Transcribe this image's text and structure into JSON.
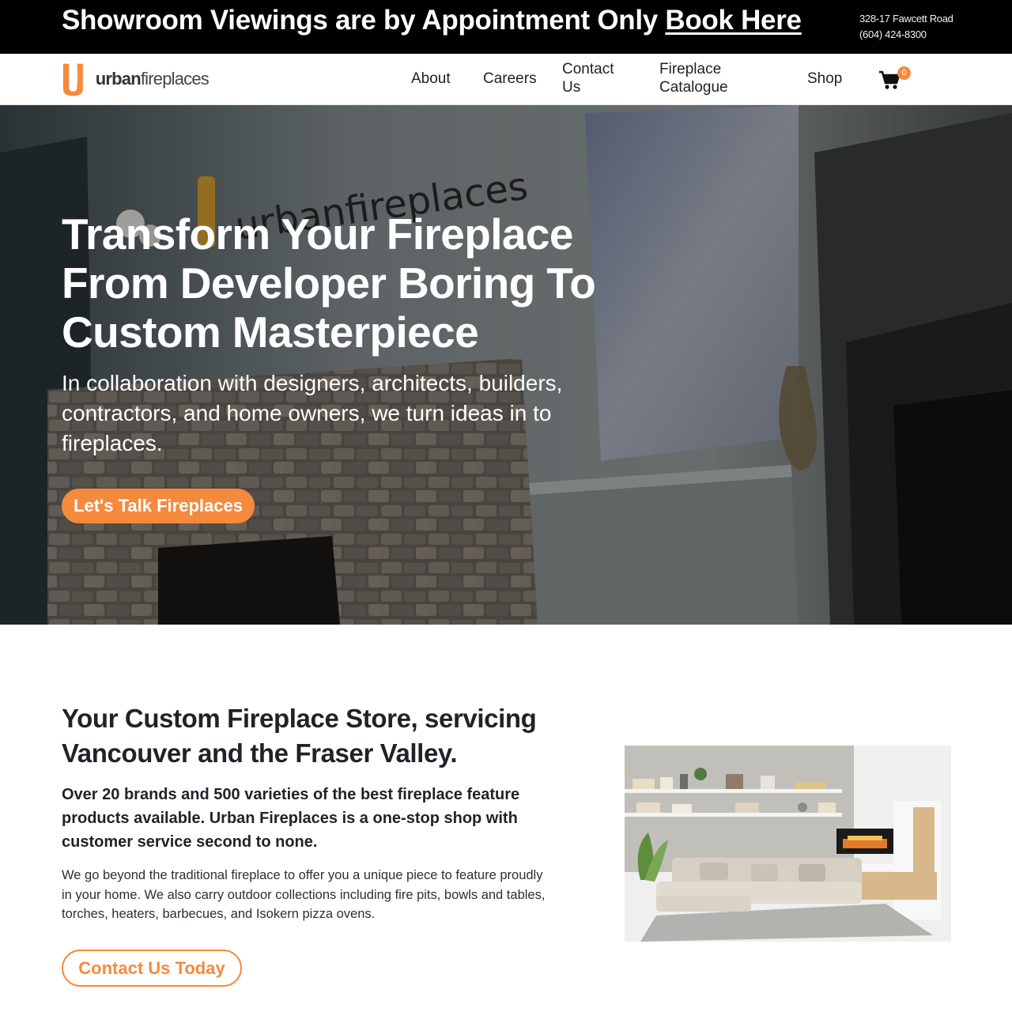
{
  "topbar": {
    "announcement": "Showroom Viewings are by Appointment Only",
    "book_link": "Book Here",
    "address": "328-17 Fawcett Road",
    "phone": "(604) 424-8300"
  },
  "header": {
    "logo_bold": "urban",
    "logo_light": "fireplaces",
    "nav": {
      "about": "About",
      "careers": "Careers",
      "contact_1": "Contact",
      "contact_2": "Us",
      "catalogue_1": "Fireplace",
      "catalogue_2": "Catalogue",
      "shop": "Shop"
    },
    "cart_count": "0",
    "icons": [
      "cart-icon",
      "logo-mark"
    ]
  },
  "hero": {
    "title": "Transform Your Fireplace From Developer Boring To Custom Masterpiece",
    "subtitle": "In collaboration with designers, architects, builders, contractors, and home owners, we turn ideas in to fireplaces.",
    "cta": "Let's Talk Fireplaces"
  },
  "intro": {
    "title": "Your Custom Fireplace Store, servicing Vancouver and the Fraser Valley.",
    "lead": "Over 20 brands and 500 varieties of the best fireplace feature products available. Urban Fireplaces is a one-stop shop with customer service second to none.",
    "body": "We go beyond the traditional fireplace to offer you a unique piece to feature proudly in your home. We also carry outdoor collections including fire pits, bowls and tables, torches, heaters, barbecues, and Isokern pizza ovens.",
    "cta": "Contact Us Today"
  },
  "colors": {
    "accent": "#f58a3c",
    "topbar_bg": "#000000",
    "text_dark": "#1f2328"
  }
}
